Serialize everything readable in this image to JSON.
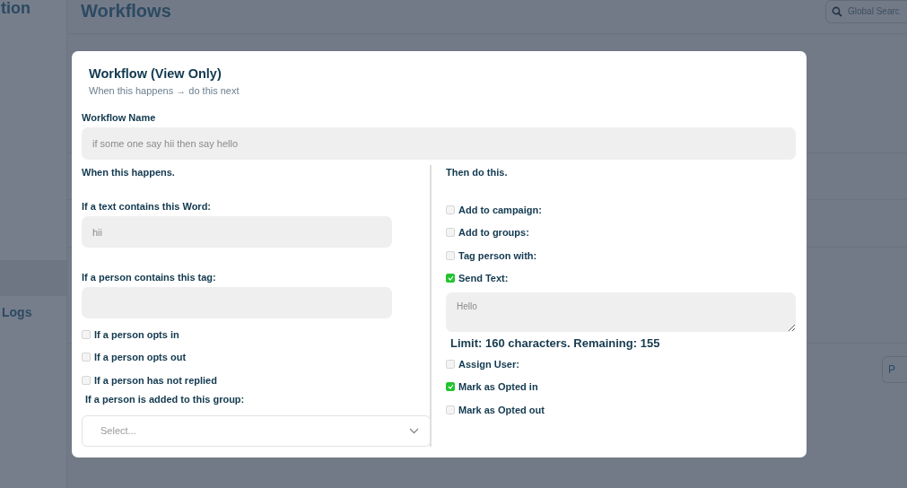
{
  "sidebar": {
    "items": [
      {
        "label": "tion"
      },
      {
        "label": "Logs"
      }
    ]
  },
  "page": {
    "title": "Workflows",
    "search": {
      "placeholder": "Global Searc"
    },
    "button": "P"
  },
  "modal": {
    "title": "Workflow (View Only)",
    "subtitle": "When this happens → do this next",
    "name_label": "Workflow Name",
    "name_value": "if some one say hii then say hello",
    "left": {
      "heading": "When this happens.",
      "word_label": "If a text contains this Word:",
      "word_value": "hii",
      "tag_label": "If a person contains this tag:",
      "conditions": [
        {
          "label": "If a person opts in",
          "checked": false
        },
        {
          "label": "If a person opts out",
          "checked": false
        },
        {
          "label": "If a person has not replied",
          "checked": false
        }
      ],
      "group_label": "If a person is added to this group:",
      "group_placeholder": "Select..."
    },
    "right": {
      "heading": "Then do this.",
      "actions": [
        {
          "kind": "checkbox",
          "label": "Add to campaign:",
          "checked": false
        },
        {
          "kind": "checkbox",
          "label": "Add to groups:",
          "checked": false
        },
        {
          "kind": "checkbox",
          "label": "Tag person with:",
          "checked": false
        },
        {
          "kind": "checkbox",
          "label": "Send Text:",
          "checked": true
        },
        {
          "kind": "message",
          "value": "Hello",
          "note": "Limit: 160 characters. Remaining: 155"
        },
        {
          "kind": "checkbox",
          "label": "Assign User:",
          "checked": false
        },
        {
          "kind": "checkbox",
          "label": "Mark as Opted in",
          "checked": true
        },
        {
          "kind": "checkbox",
          "label": "Mark as Opted out",
          "checked": false
        }
      ]
    }
  }
}
